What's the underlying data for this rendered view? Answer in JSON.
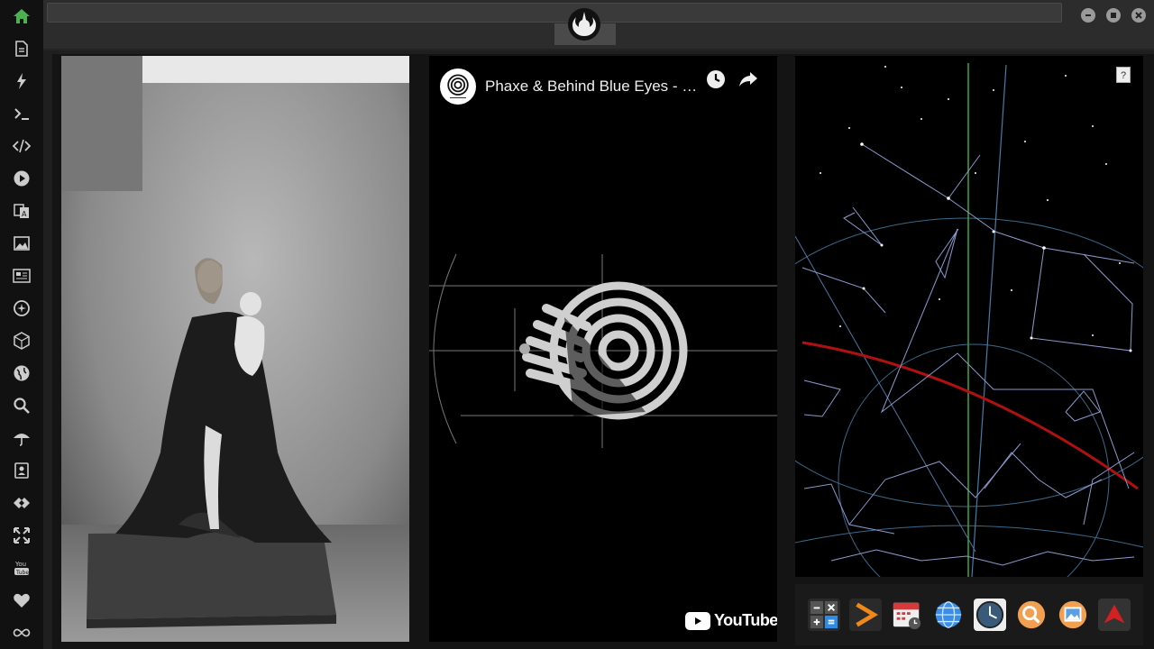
{
  "sidebar": {
    "items": [
      {
        "name": "home-icon",
        "color": "#4caf50"
      },
      {
        "name": "document-icon",
        "color": "#cccccc"
      },
      {
        "name": "lightning-icon",
        "color": "#cccccc"
      },
      {
        "name": "terminal-icon",
        "color": "#cccccc"
      },
      {
        "name": "code-icon",
        "color": "#cccccc"
      },
      {
        "name": "play-icon",
        "color": "#cccccc"
      },
      {
        "name": "translate-icon",
        "color": "#cccccc"
      },
      {
        "name": "image-icon",
        "color": "#cccccc"
      },
      {
        "name": "news-icon",
        "color": "#cccccc"
      },
      {
        "name": "settings-star-icon",
        "color": "#cccccc"
      },
      {
        "name": "cube-icon",
        "color": "#cccccc"
      },
      {
        "name": "globe-icon",
        "color": "#cccccc"
      },
      {
        "name": "search-icon",
        "color": "#cccccc"
      },
      {
        "name": "umbrella-icon",
        "color": "#cccccc"
      },
      {
        "name": "contacts-icon",
        "color": "#cccccc"
      },
      {
        "name": "diamond-code-icon",
        "color": "#cccccc"
      },
      {
        "name": "fullscreen-icon",
        "color": "#cccccc"
      },
      {
        "name": "youtube-icon",
        "color": "#cccccc"
      },
      {
        "name": "heart-icon",
        "color": "#cccccc"
      },
      {
        "name": "infinity-cloud-icon",
        "color": "#cccccc"
      }
    ]
  },
  "video": {
    "title": "Phaxe & Behind Blue Eyes - …",
    "brand": "YouTube"
  },
  "starmap": {
    "help_label": "?"
  },
  "dock": {
    "items": [
      {
        "name": "calculator-icon"
      },
      {
        "name": "arrow-right-app-icon"
      },
      {
        "name": "calendar-icon"
      },
      {
        "name": "globe-app-icon"
      },
      {
        "name": "clock-app-icon"
      },
      {
        "name": "search-app-icon"
      },
      {
        "name": "photo-app-icon"
      },
      {
        "name": "red-arrow-app-icon"
      }
    ]
  }
}
